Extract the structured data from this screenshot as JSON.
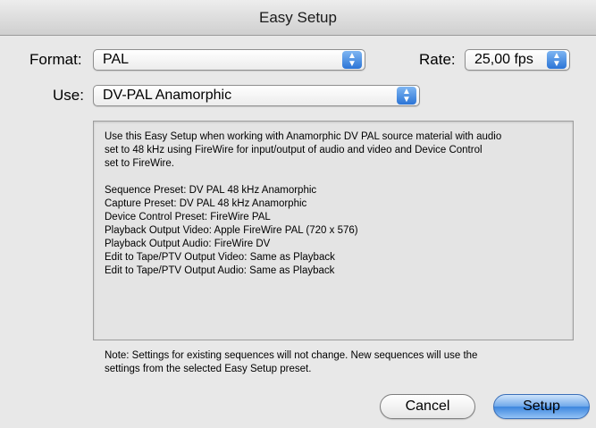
{
  "window": {
    "title": "Easy Setup"
  },
  "format": {
    "label": "Format:",
    "value": "PAL"
  },
  "rate": {
    "label": "Rate:",
    "value": "25,00 fps"
  },
  "use": {
    "label": "Use:",
    "value": "DV-PAL Anamorphic"
  },
  "description": {
    "intro_lines": [
      "Use this Easy Setup when working with Anamorphic DV PAL source material with audio",
      "set to 48 kHz using FireWire for input/output of audio and video and Device Control",
      "set to FireWire."
    ],
    "details": [
      "Sequence Preset: DV PAL 48 kHz Anamorphic",
      "Capture Preset: DV PAL 48 kHz Anamorphic",
      "Device Control Preset: FireWire PAL",
      "Playback Output Video: Apple FireWire PAL (720 x 576)",
      "Playback Output Audio: FireWire DV",
      "Edit to Tape/PTV Output Video: Same as Playback",
      "Edit to Tape/PTV Output Audio: Same as Playback"
    ]
  },
  "note_lines": [
    "Note: Settings for existing sequences will not change. New sequences will use the",
    "settings from the selected Easy Setup preset."
  ],
  "buttons": {
    "cancel": "Cancel",
    "setup": "Setup"
  },
  "colors": {
    "default_button": "#3d86de",
    "popup_arrows": "#2b74d6"
  }
}
